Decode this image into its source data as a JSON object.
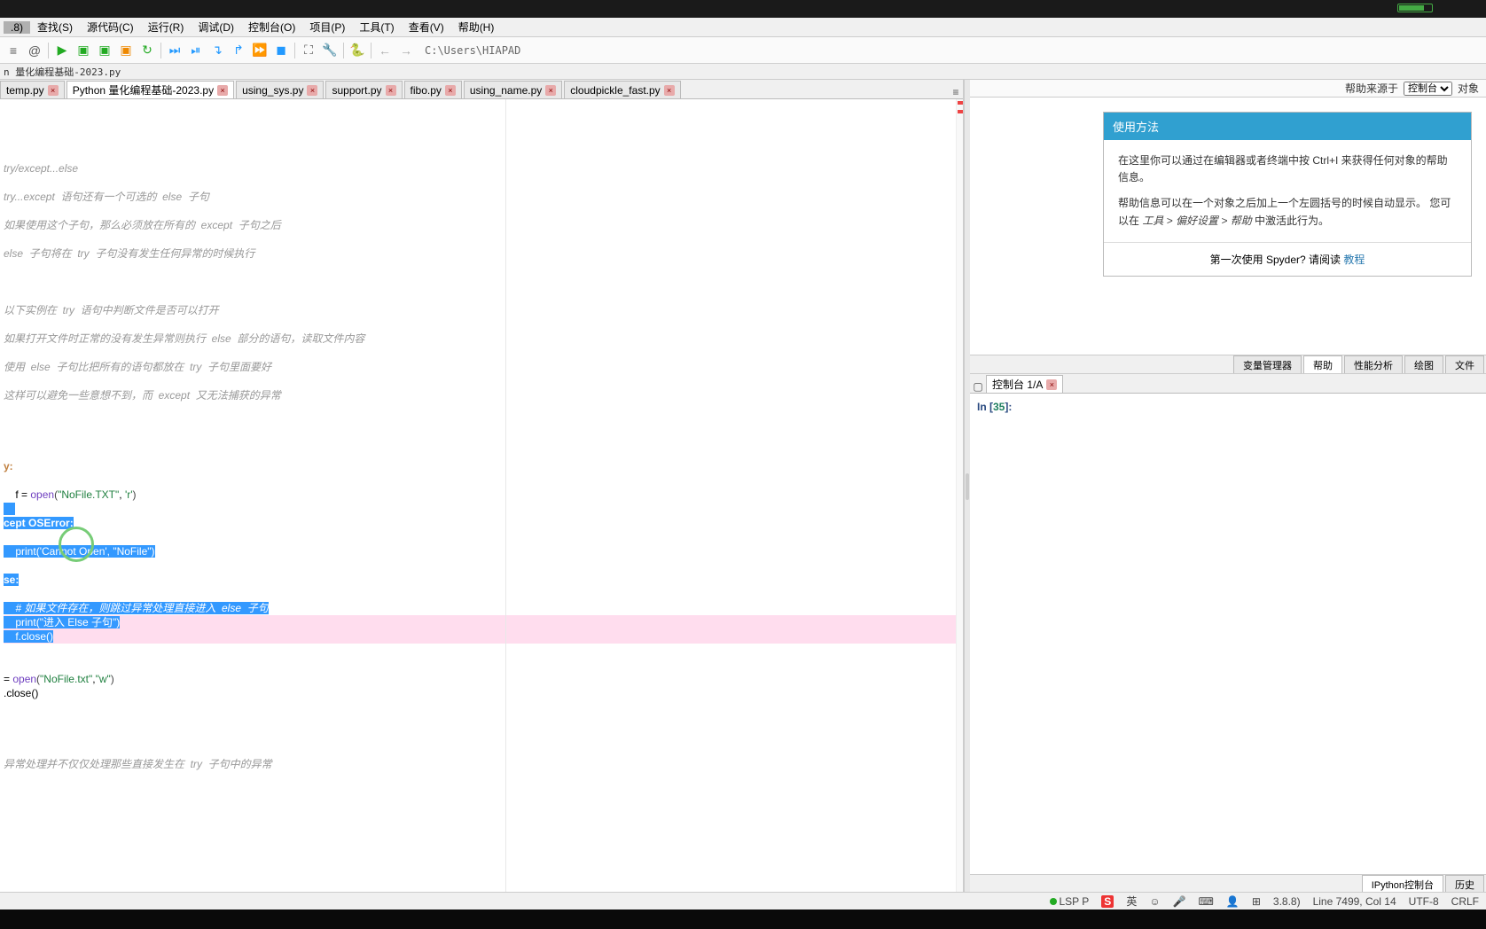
{
  "version_badge": ".8)",
  "menu": [
    "查找(S)",
    "源代码(C)",
    "运行(R)",
    "调试(D)",
    "控制台(O)",
    "项目(P)",
    "工具(T)",
    "查看(V)",
    "帮助(H)"
  ],
  "toolbar_path": "C:\\Users\\HIAPAD",
  "breadcrumb": "n 量化编程基础-2023.py",
  "tabs": [
    {
      "label": "temp.py",
      "active": false
    },
    {
      "label": "Python 量化编程基础-2023.py",
      "active": true
    },
    {
      "label": "using_sys.py",
      "active": false
    },
    {
      "label": "support.py",
      "active": false
    },
    {
      "label": "fibo.py",
      "active": false
    },
    {
      "label": "using_name.py",
      "active": false
    },
    {
      "label": "cloudpickle_fast.py",
      "active": false
    }
  ],
  "code": {
    "l1": "try/except...else",
    "l2": "try...except  语句还有一个可选的  else  子句",
    "l3": "如果使用这个子句，那么必须放在所有的  except  子句之后",
    "l4": "else  子句将在  try  子句没有发生任何异常的时候执行",
    "l5": "以下实例在  try  语句中判断文件是否可以打开",
    "l6": "如果打开文件时正常的没有发生异常则执行  else  部分的语句，读取文件内容",
    "l7": "使用  else  子句比把所有的语句都放在  try  子句里面要好",
    "l8": "这样可以避免一些意想不到，而  except  又无法捕获的异常",
    "try": "y:",
    "fopen_pre": "    f = ",
    "fopen_fn": "open",
    "fopen_paren": "(",
    "fopen_s1": "\"NoFile.TXT\"",
    "fopen_comma": ", ",
    "fopen_s2": "'r'",
    "fopen_close": ")",
    "except": "cept OSError:",
    "print1_pre": "    ",
    "print1_fn": "print",
    "print1_paren": "(",
    "print1_s1": "'Cannot Open'",
    "print1_comma": ", ",
    "print1_s2": "\"NoFile\"",
    "print1_close": ")",
    "else": "se:",
    "elsecomment": "    # 如果文件存在，则跳过异常处理直接进入  else  子句",
    "print2_pre": "    ",
    "print2_fn": "print",
    "print2_paren": "(",
    "print2_s": "\"进入 Else 子句\"",
    "print2_close": ")",
    "fclose": "    f.close()",
    "open2_pre": "= ",
    "open2_fn": "open",
    "open2_paren": "(",
    "open2_s1": "\"NoFile.txt\"",
    "open2_comma": ",",
    "open2_s2": "\"w\"",
    "open2_close": ")",
    "close2": ".close()",
    "l9": "异常处理并不仅仅处理那些直接发生在  try  子句中的异常"
  },
  "help_source_label": "帮助来源于",
  "help_source_options": [
    "控制台"
  ],
  "help_object_label": "对象",
  "help_title": "使用方法",
  "help_p1": "在这里你可以通过在编辑器或者终端中按 Ctrl+I 来获得任何对象的帮助信息。",
  "help_p2_a": "帮助信息可以在一个对象之后加上一个左圆括号的时候自动显示。 您可以在 ",
  "help_p2_b": "工具 > 偏好设置 > 帮助",
  "help_p2_c": " 中激活此行为。",
  "help_foot": "第一次使用 Spyder? 请阅读 ",
  "help_link": "教程",
  "side_tabs": [
    "变量管理器",
    "帮助",
    "性能分析",
    "绘图",
    "文件"
  ],
  "console_tab": "控制台 1/A",
  "console_prompt_in": "In [",
  "console_prompt_num": "35",
  "console_prompt_close": "]:",
  "bottom_tabs": [
    "IPython控制台",
    "历史"
  ],
  "status": {
    "lsp": "LSP P",
    "ime_lang": "英",
    "pyver": "3.8.8)",
    "line": "Line 7499, Col 14",
    "enc": "UTF-8",
    "eol": "CRLF"
  }
}
